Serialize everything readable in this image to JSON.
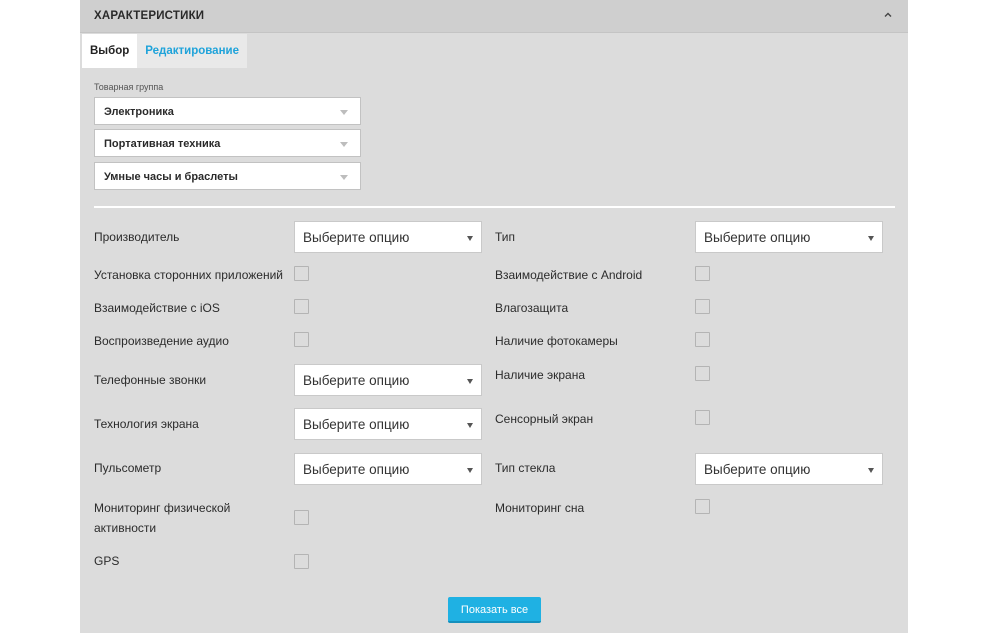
{
  "header": {
    "title": "ХАРАКТЕРИСТИКИ"
  },
  "tabs": [
    {
      "label": "Выбор",
      "active": true
    },
    {
      "label": "Редактирование",
      "active": false
    }
  ],
  "product_group": {
    "label": "Товарная группа",
    "levels": [
      "Электроника",
      "Портативная техника",
      "Умные часы и браслеты"
    ]
  },
  "attributes": {
    "manufacturer": {
      "label": "Производитель",
      "value": "Выберите опцию"
    },
    "type": {
      "label": "Тип",
      "value": "Выберите опцию"
    },
    "third_party_apps": {
      "label": "Установка сторонних приложений",
      "checked": false
    },
    "android": {
      "label": "Взаимодействие с Android",
      "checked": false
    },
    "ios": {
      "label": "Взаимодействие с iOS",
      "checked": false
    },
    "water_protection": {
      "label": "Влагозащита",
      "checked": false
    },
    "audio_playback": {
      "label": "Воспроизведение аудио",
      "checked": false
    },
    "camera": {
      "label": "Наличие фотокамеры",
      "checked": false
    },
    "phone_calls": {
      "label": "Телефонные звонки",
      "value": "Выберите опцию"
    },
    "screen": {
      "label": "Наличие экрана",
      "checked": false
    },
    "screen_tech": {
      "label": "Технология экрана",
      "value": "Выберите опцию"
    },
    "touchscreen": {
      "label": "Сенсорный экран",
      "checked": false
    },
    "heart_rate": {
      "label": "Пульсометр",
      "value": "Выберите опцию"
    },
    "glass_type": {
      "label": "Тип стекла",
      "value": "Выберите опцию"
    },
    "activity_line1": "Мониторинг физической",
    "activity_line2": "активности",
    "activity_checked": false,
    "sleep": {
      "label": "Мониторинг сна",
      "checked": false
    },
    "gps": {
      "label": "GPS",
      "checked": false
    }
  },
  "show_all_label": "Показать все",
  "icons": {
    "collapse": "chevron-up-icon"
  }
}
